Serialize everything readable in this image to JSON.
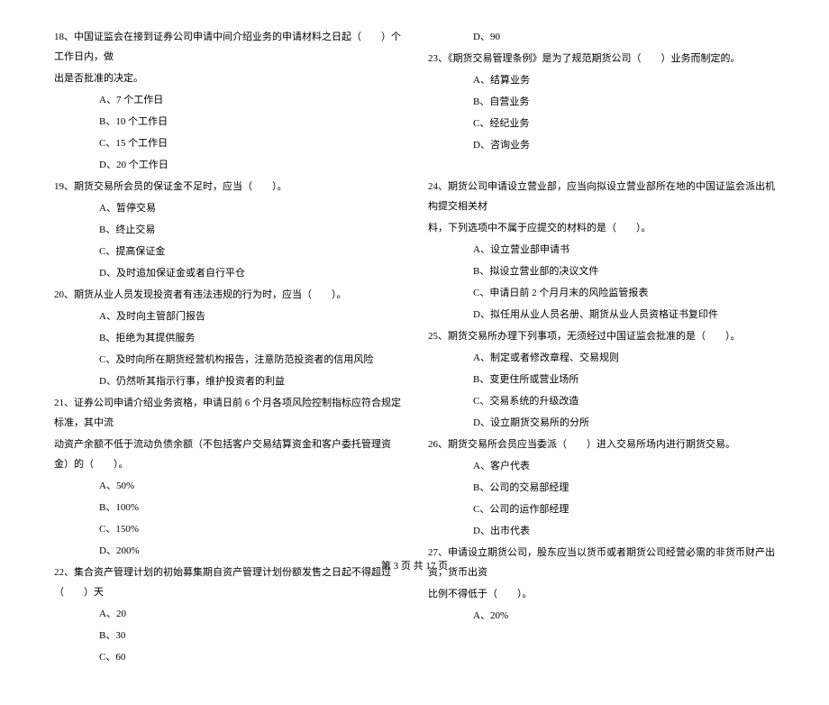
{
  "left_column": {
    "q18": {
      "text": "18、中国证监会在接到证券公司申请中间介绍业务的申请材料之日起（　　）个工作日内，做",
      "text2": "出是否批准的决定。",
      "optA": "A、7 个工作日",
      "optB": "B、10 个工作日",
      "optC": "C、15 个工作日",
      "optD": "D、20 个工作日"
    },
    "q19": {
      "text": "19、期货交易所会员的保证金不足时，应当（　　）。",
      "optA": "A、暂停交易",
      "optB": "B、终止交易",
      "optC": "C、提高保证金",
      "optD": "D、及时追加保证金或者自行平仓"
    },
    "q20": {
      "text": "20、期货从业人员发现投资者有违法违规的行为时，应当（　　）。",
      "optA": "A、及时向主管部门报告",
      "optB": "B、拒绝为其提供服务",
      "optC": "C、及时向所在期货经营机构报告，注意防范投资者的信用风险",
      "optD": "D、仍然听其指示行事，维护投资者的利益"
    },
    "q21": {
      "text": "21、证券公司申请介绍业务资格，申请日前 6 个月各项风险控制指标应符合规定标准，其中流",
      "text2": "动资产余额不低于流动负债余额（不包括客户交易结算资金和客户委托管理资金）的（　　）。",
      "optA": "A、50%",
      "optB": "B、100%",
      "optC": "C、150%",
      "optD": "D、200%"
    },
    "q22": {
      "text": "22、集合资产管理计划的初始募集期自资产管理计划份额发售之日起不得超过（　　）天",
      "optA": "A、20",
      "optB": "B、30",
      "optC": "C、60"
    }
  },
  "right_column": {
    "q22d": "D、90",
    "q23": {
      "text": "23、《期货交易管理条例》是为了规范期货公司（　　）业务而制定的。",
      "optA": "A、结算业务",
      "optB": "B、自营业务",
      "optC": "C、经纪业务",
      "optD": "D、咨询业务"
    },
    "q24": {
      "text": "24、期货公司申请设立营业部，应当向拟设立营业部所在地的中国证监会派出机构提交相关材",
      "text2": "料，下列选项中不属于应提交的材料的是（　　）。",
      "optA": "A、设立营业部申请书",
      "optB": "B、拟设立营业部的决议文件",
      "optC": "C、申请日前 2 个月月末的风险监管报表",
      "optD": "D、拟任用从业人员名册、期货从业人员资格证书复印件"
    },
    "q25": {
      "text": "25、期货交易所办理下列事项，无须经过中国证监会批准的是（　　）。",
      "optA": "A、制定或者修改章程、交易规则",
      "optB": "B、变更住所或营业场所",
      "optC": "C、交易系统的升级改造",
      "optD": "D、设立期货交易所的分所"
    },
    "q26": {
      "text": "26、期货交易所会员应当委派（　　）进入交易所场内进行期货交易。",
      "optA": "A、客户代表",
      "optB": "B、公司的交易部经理",
      "optC": "C、公司的运作部经理",
      "optD": "D、出市代表"
    },
    "q27": {
      "text": "27、申请设立期货公司，股东应当以货币或者期货公司经营必需的非货币财产出资，货币出资",
      "text2": "比例不得低于（　　）。",
      "optA": "A、20%"
    }
  },
  "footer": "第 3 页 共 17 页"
}
